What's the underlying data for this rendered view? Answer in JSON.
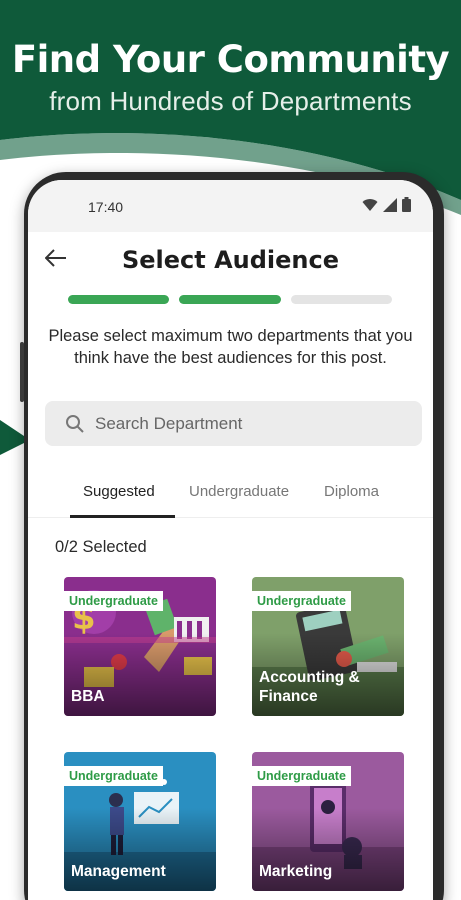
{
  "promo": {
    "title": "Find Your Community",
    "subtitle": "from Hundreds of Departments"
  },
  "status_bar": {
    "time": "17:40",
    "icons": [
      "wifi-icon",
      "signal-icon",
      "battery-icon"
    ]
  },
  "header": {
    "back_icon": "arrow-left-icon",
    "title": "Select Audience"
  },
  "progress": {
    "steps_total": 3,
    "steps_completed": 2
  },
  "instructions": "Please select maximum two departments that you think have the best audiences for this post.",
  "search": {
    "placeholder": "Search Department",
    "value": "",
    "icon": "search-icon"
  },
  "tabs": [
    {
      "label": "Suggested",
      "active": true
    },
    {
      "label": "Undergraduate",
      "active": false
    },
    {
      "label": "Diploma",
      "active": false
    }
  ],
  "selection_count": "0/2 Selected",
  "departments": [
    {
      "badge": "Undergraduate",
      "name": "BBA"
    },
    {
      "badge": "Undergraduate",
      "name": "Accounting & Finance"
    },
    {
      "badge": "Undergraduate",
      "name": "Management"
    },
    {
      "badge": "Undergraduate",
      "name": "Marketing"
    }
  ],
  "colors": {
    "brand_green": "#0f5a3a",
    "accent_green": "#3aa655",
    "badge_text": "#2e9b46"
  }
}
